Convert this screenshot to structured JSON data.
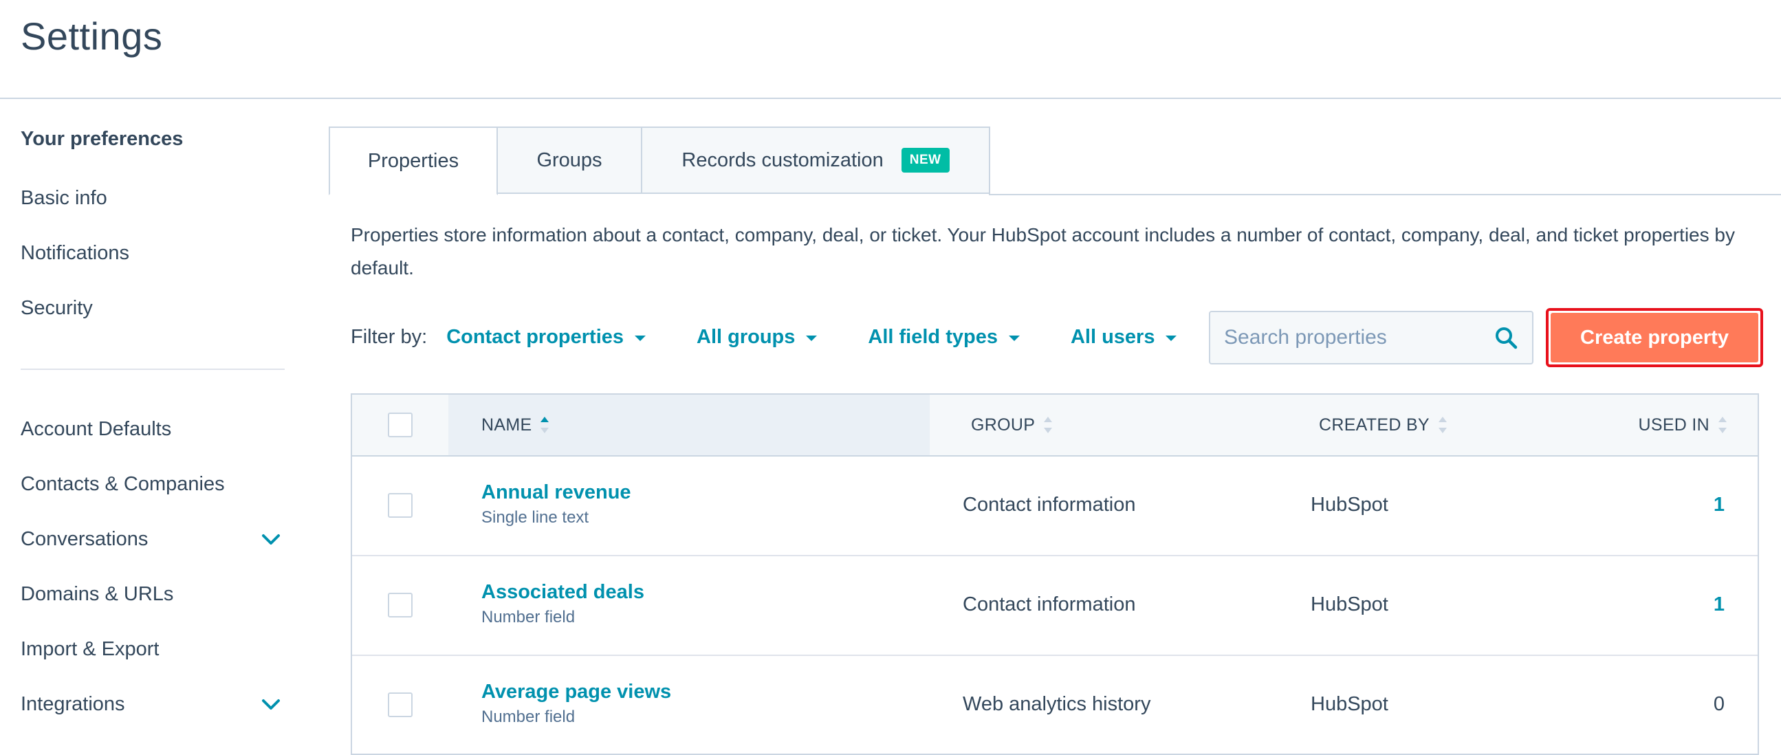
{
  "header": {
    "title": "Settings"
  },
  "sidebar": {
    "section_title": "Your preferences",
    "preference_items": [
      {
        "label": "Basic info"
      },
      {
        "label": "Notifications"
      },
      {
        "label": "Security"
      }
    ],
    "account_items": [
      {
        "label": "Account Defaults",
        "expandable": false
      },
      {
        "label": "Contacts & Companies",
        "expandable": false
      },
      {
        "label": "Conversations",
        "expandable": true,
        "icon": "chevron-down-icon"
      },
      {
        "label": "Domains & URLs",
        "expandable": false
      },
      {
        "label": "Import & Export",
        "expandable": false
      },
      {
        "label": "Integrations",
        "expandable": true,
        "icon": "chevron-down-icon"
      }
    ]
  },
  "tabs": [
    {
      "label": "Properties",
      "active": true
    },
    {
      "label": "Groups",
      "active": false
    },
    {
      "label": "Records customization",
      "active": false,
      "badge": "NEW"
    }
  ],
  "description": "Properties store information about a contact, company, deal, or ticket. Your HubSpot account includes a number of contact, company, deal, and ticket properties by default.",
  "filters": {
    "label": "Filter by:",
    "object_type": "Contact properties",
    "groups": "All groups",
    "field_types": "All field types",
    "users": "All users"
  },
  "search": {
    "placeholder": "Search properties",
    "icon": "search-icon"
  },
  "create_button": {
    "label": "Create property"
  },
  "table": {
    "columns": {
      "name": "NAME",
      "group": "GROUP",
      "created_by": "CREATED BY",
      "used_in": "USED IN"
    },
    "sorted_column": "name",
    "rows": [
      {
        "name": "Annual revenue",
        "type": "Single line text",
        "group": "Contact information",
        "created_by": "HubSpot",
        "used_in": "1"
      },
      {
        "name": "Associated deals",
        "type": "Number field",
        "group": "Contact information",
        "created_by": "HubSpot",
        "used_in": "1"
      },
      {
        "name": "Average page views",
        "type": "Number field",
        "group": "Web analytics history",
        "created_by": "HubSpot",
        "used_in": "0"
      }
    ]
  },
  "colors": {
    "accent": "#0091ae",
    "create_button": "#ff7a59",
    "badge": "#00bda5",
    "text": "#33475b",
    "highlight_border": "#e8111c"
  }
}
